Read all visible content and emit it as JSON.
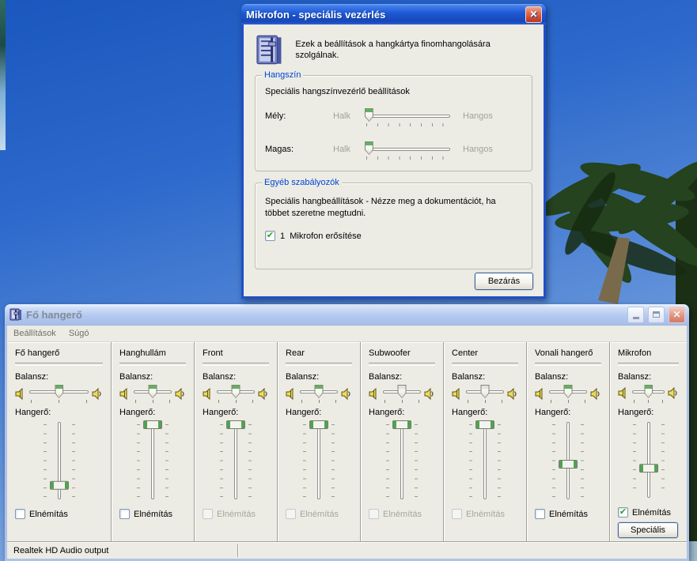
{
  "colors": {
    "active_titlebar": "#1D57D2",
    "inactive_titlebar": "#B0C7EF",
    "window_face": "#ECEBE4",
    "group_label_blue": "#0046D5",
    "slider_green": "#4FA44F",
    "check_green": "#2BA32B",
    "close_button_red": "#C33C22"
  },
  "advanced_dialog": {
    "title": "Mikrofon - speciális vezérlés",
    "description": "Ezek a beállítások a hangkártya finomhangolására szolgálnak.",
    "tone_group": {
      "label": "Hangszín",
      "subtitle": "Speciális hangszínvezérlő beállítások",
      "sliders": [
        {
          "name": "Mély:",
          "left_label": "Halk",
          "right_label": "Hangos",
          "value_percent": 2
        },
        {
          "name": "Magas:",
          "left_label": "Halk",
          "right_label": "Hangos",
          "value_percent": 2
        }
      ]
    },
    "other_group": {
      "label": "Egyéb szabályozók",
      "text": "Speciális hangbeállítások - Nézze meg a dokumentációt, ha többet szeretne megtudni.",
      "checkbox": {
        "label": "1  Mikrofon erősítése",
        "checked": true
      }
    },
    "close_button": "Bezárás"
  },
  "mixer_window": {
    "title": "Fő hangerő",
    "menu": [
      "Beállítások",
      "Súgó"
    ],
    "labels": {
      "balance": "Balansz:",
      "volume": "Hangerő:",
      "mute": "Elnémítás"
    },
    "advanced_button": "Speciális",
    "status_bar": "Realtek HD Audio output",
    "channels": [
      {
        "name": "Fő hangerő",
        "balance_percent": 50,
        "balance_enabled": true,
        "volume_percent": 84,
        "mute_enabled": true,
        "muted": false,
        "has_advanced": false
      },
      {
        "name": "Hanghullám",
        "balance_percent": 50,
        "balance_enabled": true,
        "volume_percent": 0,
        "mute_enabled": true,
        "muted": false,
        "has_advanced": false
      },
      {
        "name": "Front",
        "balance_percent": 50,
        "balance_enabled": true,
        "volume_percent": 0,
        "mute_enabled": false,
        "muted": false,
        "has_advanced": false
      },
      {
        "name": "Rear",
        "balance_percent": 50,
        "balance_enabled": true,
        "volume_percent": 0,
        "mute_enabled": false,
        "muted": false,
        "has_advanced": false
      },
      {
        "name": "Subwoofer",
        "balance_percent": 50,
        "balance_enabled": false,
        "volume_percent": 0,
        "mute_enabled": false,
        "muted": false,
        "has_advanced": false
      },
      {
        "name": "Center",
        "balance_percent": 50,
        "balance_enabled": false,
        "volume_percent": 0,
        "mute_enabled": false,
        "muted": false,
        "has_advanced": false
      },
      {
        "name": "Vonali hangerő",
        "balance_percent": 50,
        "balance_enabled": true,
        "volume_percent": 55,
        "mute_enabled": true,
        "muted": false,
        "has_advanced": false
      },
      {
        "name": "Mikrofon",
        "balance_percent": 50,
        "balance_enabled": true,
        "volume_percent": 62,
        "mute_enabled": true,
        "muted": true,
        "has_advanced": true
      }
    ]
  }
}
